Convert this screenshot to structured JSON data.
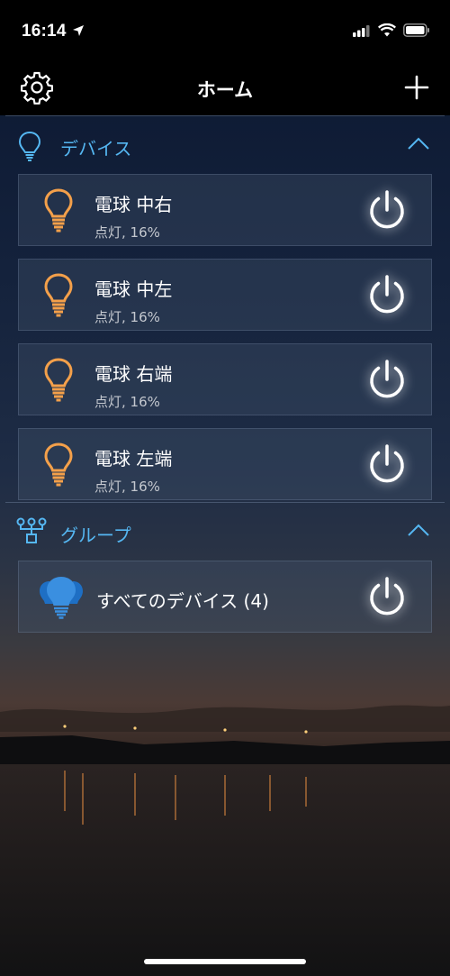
{
  "status_bar": {
    "time": "16:14"
  },
  "nav": {
    "title": "ホーム"
  },
  "devices": {
    "title": "デバイス",
    "items": [
      {
        "name": "電球 中右",
        "status": "点灯, 16%"
      },
      {
        "name": "電球 中左",
        "status": "点灯, 16%"
      },
      {
        "name": "電球 右端",
        "status": "点灯, 16%"
      },
      {
        "name": "電球 左端",
        "status": "点灯, 16%"
      }
    ]
  },
  "groups": {
    "title": "グループ",
    "items": [
      {
        "name": "すべてのデバイス (4)"
      }
    ]
  },
  "colors": {
    "accent": "#55b7f2",
    "bulb": "#f4a04a",
    "group_bulb": "#3a8fe0"
  },
  "icons": {
    "settings": "gear-icon",
    "add": "plus-icon",
    "devices": "lightbulb-icon",
    "groups": "network-icon",
    "collapse": "chevron-up-icon",
    "power": "power-icon"
  }
}
